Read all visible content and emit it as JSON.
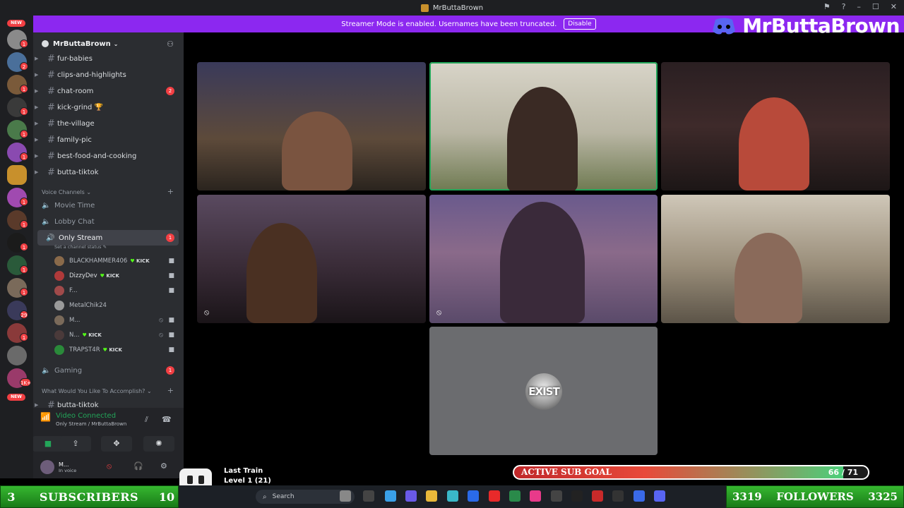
{
  "window": {
    "title": "MrButtaBrown"
  },
  "banner": {
    "message": "Streamer Mode is enabled. Usernames have been truncated.",
    "disable_label": "Disable"
  },
  "brand": {
    "name": "MrButtaBrown"
  },
  "rail": {
    "new_label_top": "NEW",
    "new_label_bottom": "NEW",
    "badges": [
      "1",
      "2",
      "1",
      "1",
      "1",
      "1",
      "1",
      "1",
      "1",
      "1",
      "1",
      "1",
      "1",
      "1",
      "1",
      "1",
      "1",
      "29",
      "1",
      "1",
      "1",
      "1K+",
      "1"
    ]
  },
  "server": {
    "name": "MrButtaBrown",
    "text_channels": [
      {
        "name": "fur-babies",
        "badge": ""
      },
      {
        "name": "clips-and-highlights",
        "badge": ""
      },
      {
        "name": "chat-room",
        "badge": "2"
      },
      {
        "name": "kick-grind 🏆",
        "badge": ""
      },
      {
        "name": "the-village",
        "badge": ""
      },
      {
        "name": "family-pic",
        "badge": ""
      },
      {
        "name": "best-food-and-cooking",
        "badge": ""
      },
      {
        "name": "butta-tiktok",
        "badge": ""
      }
    ],
    "voice_category": "Voice Channels",
    "voice_channels": [
      {
        "name": "Movie Time"
      },
      {
        "name": "Lobby Chat"
      },
      {
        "name": "Only Stream",
        "badge": "1",
        "status": "Set a channel status"
      }
    ],
    "members": [
      {
        "name": "BLACKHAMMER406",
        "kick": "KICK"
      },
      {
        "name": "DizzyDev",
        "kick": "KICK"
      },
      {
        "name": "F...",
        "kick": ""
      },
      {
        "name": "MetalChik24",
        "kick": ""
      },
      {
        "name": "M...",
        "kick": ""
      },
      {
        "name": "N...",
        "kick": "KICK"
      },
      {
        "name": "TRAPST4R",
        "kick": "KICK"
      }
    ],
    "gaming": {
      "name": "Gaming",
      "badge": "1"
    },
    "category2": "What Would You Like To Accomplish?",
    "partial_channel": "butta-tiktok"
  },
  "voice_panel": {
    "status": "Video Connected",
    "location": "Only Stream / MrButtaBrown"
  },
  "user": {
    "name": "M...",
    "status": "In voice"
  },
  "stream": {
    "exist_label": "EXIST"
  },
  "goal": {
    "label": "ACTIVE SUB GOAL",
    "count": "66 / 71",
    "progress": 0.93
  },
  "now_playing": {
    "title": "Last Train",
    "level": "Level 1 (21)"
  },
  "subs": {
    "left": "3",
    "label": "SUBSCRIBERS",
    "right": "10"
  },
  "followers": {
    "left": "3319",
    "label": "FOLLOWERS",
    "right": "3325"
  },
  "taskbar": {
    "search_placeholder": "Search"
  }
}
